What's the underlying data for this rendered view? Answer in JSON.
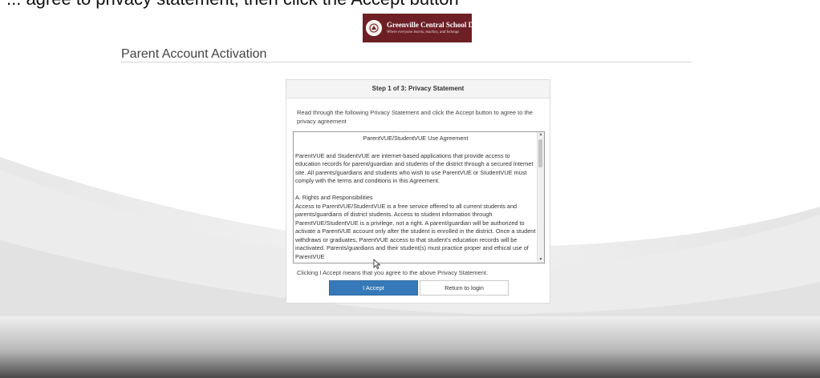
{
  "caption": {
    "text": "... agree to privacy statement, then click the Accept button"
  },
  "logo": {
    "name": "Greenville Central School District",
    "tagline": "Where everyone learns, teaches, and belongs",
    "bg_color": "#6e1f26"
  },
  "page": {
    "title": "Parent Account Activation"
  },
  "panel": {
    "step_title": "Step 1 of 3: Privacy Statement",
    "instructions": "Read through the following Privacy Statement and click the Accept button to agree to the privacy agreement",
    "agreement": {
      "title": "ParentVUE/StudentVUE Use Agreement",
      "intro": "ParentVUE and StudentVUE are internet-based applications that provide access to education records for parent/guardian and students of the district through a secured Internet site. All parents/guardians and students who wish to use ParentVUE or StudentVUE must comply with the terms and conditions in this Agreement.",
      "section_heading": "A. Rights and Responsibilities",
      "section_body": "Access to ParentVUE/StudentVUE is a free service offered to all current students and parents/guardians of district students. Access to student information through ParentVUE/StudentVUE is a privilege, not a right. A parent/guardian will be authorized to activate a ParentVUE account only after the student is enrolled in the district. Once a student withdraws or graduates, ParentVUE access to that student's education records will be inactivated. Parents/guardians and their student(s) must practice proper and ethical use of ParentVUE"
    },
    "accept_note": "Clicking I Accept means that you agree to the above Privacy Statement.",
    "accept_button": "I Accept",
    "return_button": "Return to login"
  },
  "colors": {
    "primary_button": "#3779b8",
    "logo_bg": "#6e1f26"
  },
  "icons": {
    "seal": "district-seal-icon",
    "scroll_up": "scroll-up-arrow-icon",
    "scroll_down": "scroll-down-arrow-icon",
    "cursor": "mouse-cursor-icon"
  }
}
